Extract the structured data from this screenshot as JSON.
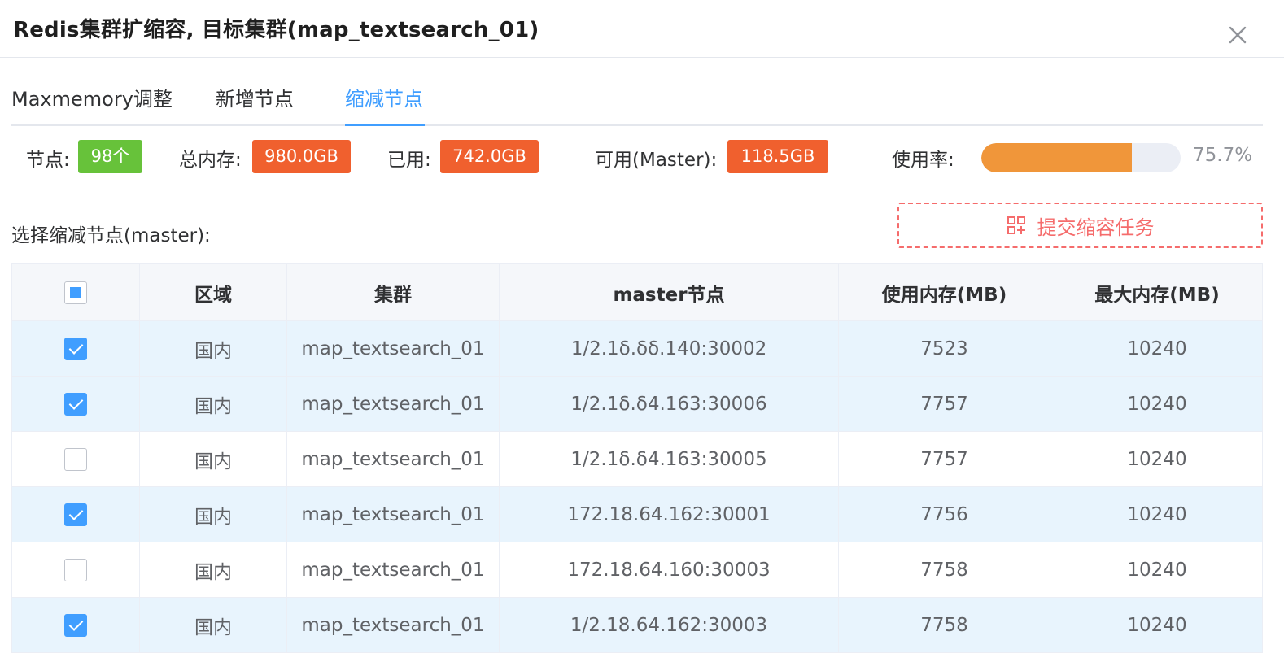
{
  "dialog": {
    "title": "Redis集群扩缩容, 目标集群(map_textsearch_01)",
    "close_label": "X"
  },
  "tabs": [
    {
      "label": "Maxmemory调整",
      "active": false
    },
    {
      "label": "新增节点",
      "active": false
    },
    {
      "label": "缩减节点",
      "active": true
    }
  ],
  "stats": {
    "nodes_label": "节点:",
    "nodes_value": "98个",
    "total_label": "总内存:",
    "total_value": "980.0GB",
    "used_label": "已用:",
    "used_value": "742.0GB",
    "available_label": "可用(Master):",
    "available_value": "118.5GB",
    "usage_label": "使用率:",
    "usage_percent": 75.7,
    "usage_text": "75.7%"
  },
  "select_label": "选择缩减节点(master):",
  "submit_button": {
    "label": "提交缩容任务",
    "icon": "grid-plus-icon"
  },
  "table": {
    "columns": [
      "区域",
      "集群",
      "master节点",
      "使用内存(MB)",
      "最大内存(MB)"
    ],
    "rows": [
      {
        "checked": true,
        "region": "国内",
        "cluster": "map_textsearch_01",
        "node": "1/2.1δ.δδ.140:30002",
        "used": "7523",
        "max": "10240"
      },
      {
        "checked": true,
        "region": "国内",
        "cluster": "map_textsearch_01",
        "node": "1/2.1δ.δ4.163:30006",
        "used": "7757",
        "max": "10240"
      },
      {
        "checked": false,
        "region": "国内",
        "cluster": "map_textsearch_01",
        "node": "1/2.1δ.δ4.163:30005",
        "used": "7757",
        "max": "10240"
      },
      {
        "checked": true,
        "region": "国内",
        "cluster": "map_textsearch_01",
        "node": "172.18.64.162:30001",
        "used": "7756",
        "max": "10240"
      },
      {
        "checked": false,
        "region": "国内",
        "cluster": "map_textsearch_01",
        "node": "172.18.64.160:30003",
        "used": "7758",
        "max": "10240"
      },
      {
        "checked": true,
        "region": "国内",
        "cluster": "map_textsearch_01",
        "node": "1/2.18.64.162:30003",
        "used": "7758",
        "max": "10240"
      }
    ]
  },
  "colors": {
    "primary": "#409eff",
    "success": "#67c23a",
    "danger_tag": "#f0602e",
    "danger_text": "#f56c6c",
    "progress": "#f0963a",
    "checked_row_bg": "#e8f4fd"
  }
}
